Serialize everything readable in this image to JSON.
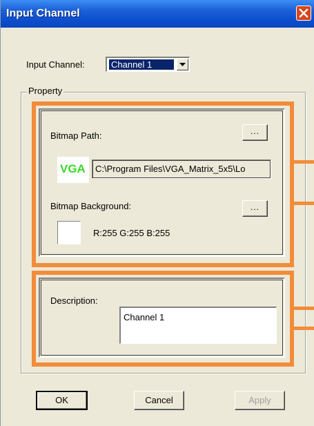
{
  "window": {
    "title": "Input Channel"
  },
  "input_channel": {
    "label": "Input Channel:",
    "selected": "Channel 1"
  },
  "property": {
    "legend": "Property",
    "bitmap_path": {
      "label": "Bitmap Path:",
      "browse_label": "...",
      "logo_text": "VGA",
      "path_value": "C:\\Program Files\\VGA_Matrix_5x5\\Lo"
    },
    "bitmap_background": {
      "label": "Bitmap Background:",
      "browse_label": "...",
      "rgb_text": "R:255  G:255  B:255",
      "swatch_color": "#ffffff"
    },
    "description": {
      "label": "Description:",
      "value": "Channel 1"
    }
  },
  "buttons": {
    "ok": "OK",
    "cancel": "Cancel",
    "apply": "Apply"
  },
  "colors": {
    "highlight": "#f28c3a",
    "title_bar": "#0d4fce",
    "logo_green": "#39d92a"
  }
}
